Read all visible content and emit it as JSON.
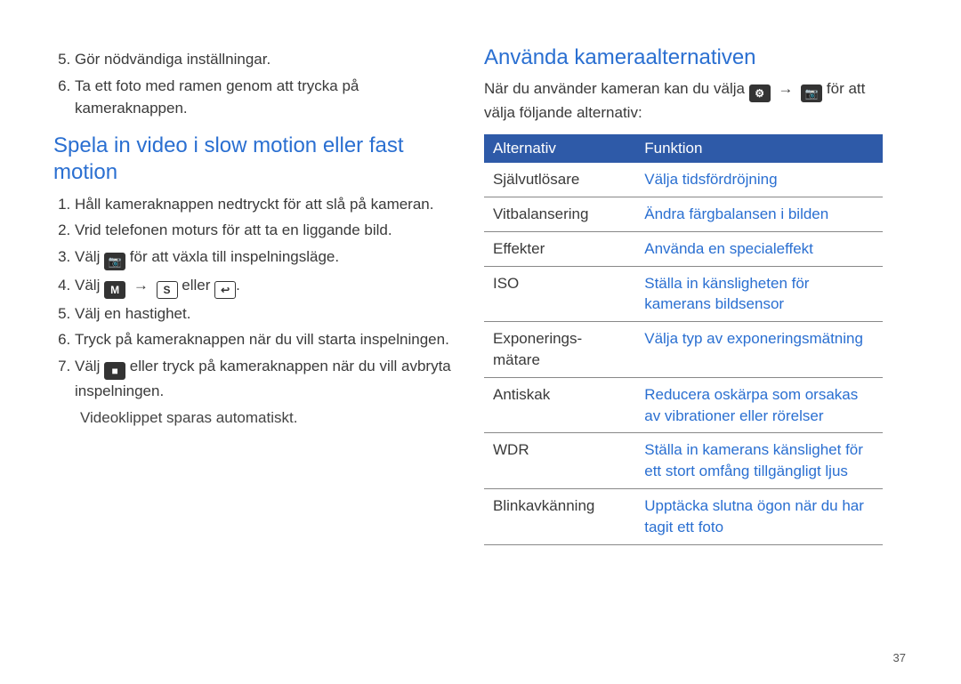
{
  "left": {
    "topList": [
      "Gör nödvändiga inställningar.",
      "Ta ett foto med ramen genom att trycka på kameraknappen."
    ],
    "topStart": "5",
    "heading": "Spela in video i slow motion eller fast motion",
    "steps": [
      "Håll kameraknappen nedtryckt för att slå på kameran.",
      "Vrid telefonen moturs för att ta en liggande bild.",
      "Välj  för att växla till inspelningsläge.",
      "Välj  →  eller .",
      "Välj en hastighet.",
      "Tryck på kameraknappen när du vill starta inspelningen.",
      "Välj  eller tryck på kameraknappen när du vill avbryta inspelningen."
    ],
    "note": "Videoklippet sparas automatiskt.",
    "icons": {
      "camera": "📷",
      "menu": "M",
      "fast": "S",
      "slow": "↩",
      "stop": "■",
      "gear": "⚙"
    }
  },
  "right": {
    "heading": "Använda kameraalternativen",
    "lead_before": "När du använder kameran kan du välja ",
    "lead_after": " för att välja följande alternativ:",
    "tableHead": {
      "alt": "Alternativ",
      "fn": "Funktion"
    },
    "rows": [
      {
        "alt": "Självutlösare",
        "fn": "Välja tidsfördröjning"
      },
      {
        "alt": "Vitbalansering",
        "fn": "Ändra färgbalansen i bilden"
      },
      {
        "alt": "Effekter",
        "fn": "Använda en specialeffekt"
      },
      {
        "alt": "ISO",
        "fn": "Ställa in känsligheten för kamerans bildsensor"
      },
      {
        "alt": "Exponerings-\nmätare",
        "fn": "Välja typ av exponeringsmätning"
      },
      {
        "alt": "Antiskak",
        "fn": "Reducera oskärpa som orsakas av vibrationer eller rörelser"
      },
      {
        "alt": "WDR",
        "fn": "Ställa in kamerans känslighet för ett stort omfång tillgängligt ljus"
      },
      {
        "alt": "Blinkavkänning",
        "fn": "Upptäcka slutna ögon när du har tagit ett foto"
      }
    ]
  },
  "pageNumber": "37"
}
